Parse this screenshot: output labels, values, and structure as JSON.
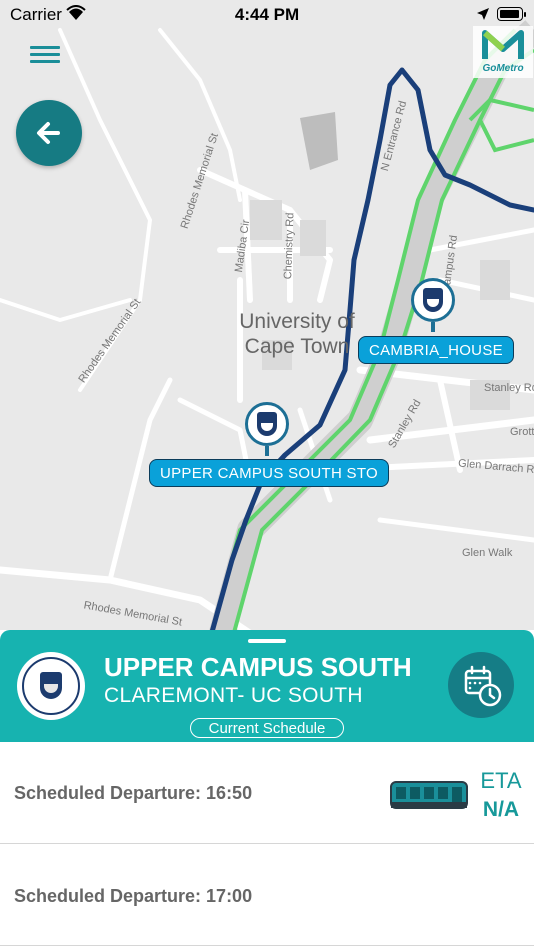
{
  "status_bar": {
    "carrier": "Carrier",
    "time": "4:44 PM"
  },
  "brand": {
    "logo_text": "GoMetro"
  },
  "map": {
    "place_label": "University of\nCape Town",
    "street_labels": {
      "rhodes_memorial_1": "Rhodes Memorial St",
      "rhodes_memorial_2": "Rhodes Memorial St",
      "rhodes_memorial_3": "Rhodes Memorial St",
      "n_entrance": "N Entrance Rd",
      "madiba": "Madiba Cir",
      "chemistry": "Chemistry Rd",
      "campus": "Campus Rd",
      "stanley_1": "Stanley Rd",
      "stanley_2": "Stanley Rd",
      "grotto": "Grotto",
      "glen_darrach": "Glen Darrach Rd",
      "glen_walk": "Glen Walk"
    },
    "stops": [
      {
        "label": "CAMBRIA_HOUSE"
      },
      {
        "label": "UPPER CAMPUS SOUTH STO"
      }
    ]
  },
  "panel": {
    "title": "UPPER CAMPUS SOUTH",
    "subtitle": "CLAREMONT- UC SOUTH",
    "schedule_label": "Current Schedule"
  },
  "departures": [
    {
      "label": "Scheduled Departure: 16:50",
      "eta_label": "ETA",
      "eta_value": "N/A"
    },
    {
      "label": "Scheduled Departure: 17:00"
    }
  ],
  "icons": {
    "menu": "hamburger-icon",
    "back": "arrow-left-icon",
    "calendar": "calendar-clock-icon",
    "bus": "bus-icon"
  },
  "colors": {
    "teal": "#17b3b0",
    "dark_teal": "#157d86",
    "route_dark": "#1a3f7a",
    "route_green": "#5fd46c",
    "stop_label": "#0aa1d9"
  }
}
